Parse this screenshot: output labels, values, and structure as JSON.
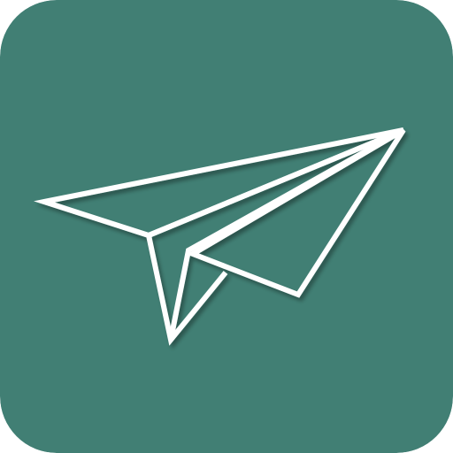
{
  "app_icon": {
    "icon": "paper-plane-icon",
    "background_color": "#417F74",
    "stroke_color": "#FFFFFF"
  }
}
